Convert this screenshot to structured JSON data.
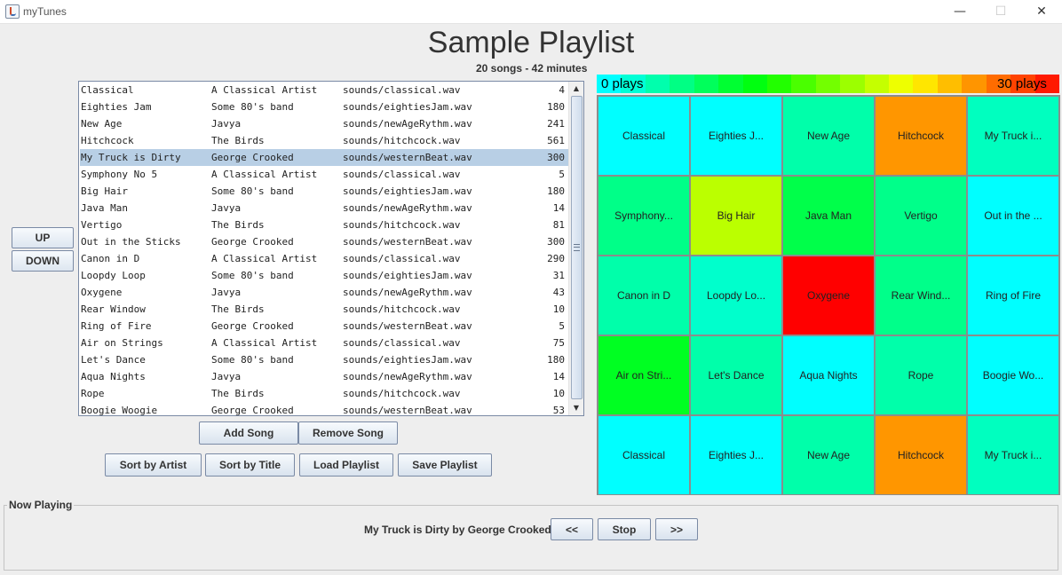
{
  "window": {
    "title": "myTunes",
    "minimize_glyph": "—",
    "maximize_glyph": "☐",
    "close_glyph": "✕"
  },
  "header": {
    "title": "Sample Playlist",
    "summary": "20 songs - 42 minutes"
  },
  "side_buttons": {
    "up": "UP",
    "down": "DOWN"
  },
  "playlist": {
    "selected_index": 4,
    "songs": [
      {
        "title": "Classical",
        "artist": "A Classical Artist",
        "file": "sounds/classical.wav",
        "plays": "4"
      },
      {
        "title": "Eighties Jam",
        "artist": "Some 80's band",
        "file": "sounds/eightiesJam.wav",
        "plays": "180"
      },
      {
        "title": "New Age",
        "artist": "Javya",
        "file": "sounds/newAgeRythm.wav",
        "plays": "241"
      },
      {
        "title": "Hitchcock",
        "artist": "The Birds",
        "file": "sounds/hitchcock.wav",
        "plays": "561"
      },
      {
        "title": "My Truck is Dirty",
        "artist": "George Crooked",
        "file": "sounds/westernBeat.wav",
        "plays": "300"
      },
      {
        "title": "Symphony No 5",
        "artist": "A Classical Artist",
        "file": "sounds/classical.wav",
        "plays": "5"
      },
      {
        "title": "Big Hair",
        "artist": "Some 80's band",
        "file": "sounds/eightiesJam.wav",
        "plays": "180"
      },
      {
        "title": "Java Man",
        "artist": "Javya",
        "file": "sounds/newAgeRythm.wav",
        "plays": "14"
      },
      {
        "title": "Vertigo",
        "artist": "The Birds",
        "file": "sounds/hitchcock.wav",
        "plays": "81"
      },
      {
        "title": "Out in the Sticks",
        "artist": "George Crooked",
        "file": "sounds/westernBeat.wav",
        "plays": "300"
      },
      {
        "title": "Canon in D",
        "artist": "A Classical Artist",
        "file": "sounds/classical.wav",
        "plays": "290"
      },
      {
        "title": "Loopdy Loop",
        "artist": "Some 80's band",
        "file": "sounds/eightiesJam.wav",
        "plays": "31"
      },
      {
        "title": "Oxygene",
        "artist": "Javya",
        "file": "sounds/newAgeRythm.wav",
        "plays": "43"
      },
      {
        "title": "Rear Window",
        "artist": "The Birds",
        "file": "sounds/hitchcock.wav",
        "plays": "10"
      },
      {
        "title": "Ring of Fire",
        "artist": "George Crooked",
        "file": "sounds/westernBeat.wav",
        "plays": "5"
      },
      {
        "title": "Air on Strings",
        "artist": "A Classical Artist",
        "file": "sounds/classical.wav",
        "plays": "75"
      },
      {
        "title": "Let's Dance",
        "artist": "Some 80's band",
        "file": "sounds/eightiesJam.wav",
        "plays": "180"
      },
      {
        "title": "Aqua Nights",
        "artist": "Javya",
        "file": "sounds/newAgeRythm.wav",
        "plays": "14"
      },
      {
        "title": "Rope",
        "artist": "The Birds",
        "file": "sounds/hitchcock.wav",
        "plays": "10"
      },
      {
        "title": "Boogie Woogie",
        "artist": "George Crooked",
        "file": "sounds/westernBeat.wav",
        "plays": "53"
      }
    ]
  },
  "buttons": {
    "add_song": "Add Song",
    "remove_song": "Remove Song",
    "sort_artist": "Sort by Artist",
    "sort_title": "Sort by Title",
    "load_playlist": "Load Playlist",
    "save_playlist": "Save Playlist"
  },
  "heatmap": {
    "legend_min": "0 plays",
    "legend_max": "30 plays",
    "legend_colors": [
      "#00ffff",
      "#00ffd6",
      "#00ffad",
      "#00ff84",
      "#00ff5b",
      "#00ff32",
      "#00ff10",
      "#22ff00",
      "#4aff00",
      "#73ff00",
      "#9cff00",
      "#c5ff00",
      "#eeff00",
      "#ffe600",
      "#ffbe00",
      "#ff9500",
      "#ff6c00",
      "#ff4300",
      "#ff1a00"
    ],
    "cells": [
      {
        "label": "Classical",
        "color": "#00ffff"
      },
      {
        "label": "Eighties J...",
        "color": "#00ffff"
      },
      {
        "label": "New Age",
        "color": "#00ffaa"
      },
      {
        "label": "Hitchcock",
        "color": "#ff9600"
      },
      {
        "label": "My Truck i...",
        "color": "#00ffbf"
      },
      {
        "label": "Symphony...",
        "color": "#00ff88"
      },
      {
        "label": "Big Hair",
        "color": "#bbff00"
      },
      {
        "label": "Java Man",
        "color": "#00ff4a"
      },
      {
        "label": "Vertigo",
        "color": "#00ff8a"
      },
      {
        "label": "Out in the ...",
        "color": "#00ffff"
      },
      {
        "label": "Canon in D",
        "color": "#00ffaa"
      },
      {
        "label": "Loopdy Lo...",
        "color": "#00ffcc"
      },
      {
        "label": "Oxygene",
        "color": "#ff0000"
      },
      {
        "label": "Rear Wind...",
        "color": "#00ff8a"
      },
      {
        "label": "Ring of Fire",
        "color": "#00ffff"
      },
      {
        "label": "Air on Stri...",
        "color": "#00ff22"
      },
      {
        "label": "Let's Dance",
        "color": "#00ffaa"
      },
      {
        "label": "Aqua Nights",
        "color": "#00ffff"
      },
      {
        "label": "Rope",
        "color": "#00ffaa"
      },
      {
        "label": "Boogie Wo...",
        "color": "#00ffff"
      },
      {
        "label": "Classical",
        "color": "#00ffff"
      },
      {
        "label": "Eighties J...",
        "color": "#00ffff"
      },
      {
        "label": "New Age",
        "color": "#00ffaa"
      },
      {
        "label": "Hitchcock",
        "color": "#ff9600"
      },
      {
        "label": "My Truck i...",
        "color": "#00ffbf"
      }
    ]
  },
  "now_playing": {
    "legend": "Now Playing",
    "text": "My Truck is Dirty by George Crooked",
    "prev": "<<",
    "stop": "Stop",
    "next": ">>"
  }
}
